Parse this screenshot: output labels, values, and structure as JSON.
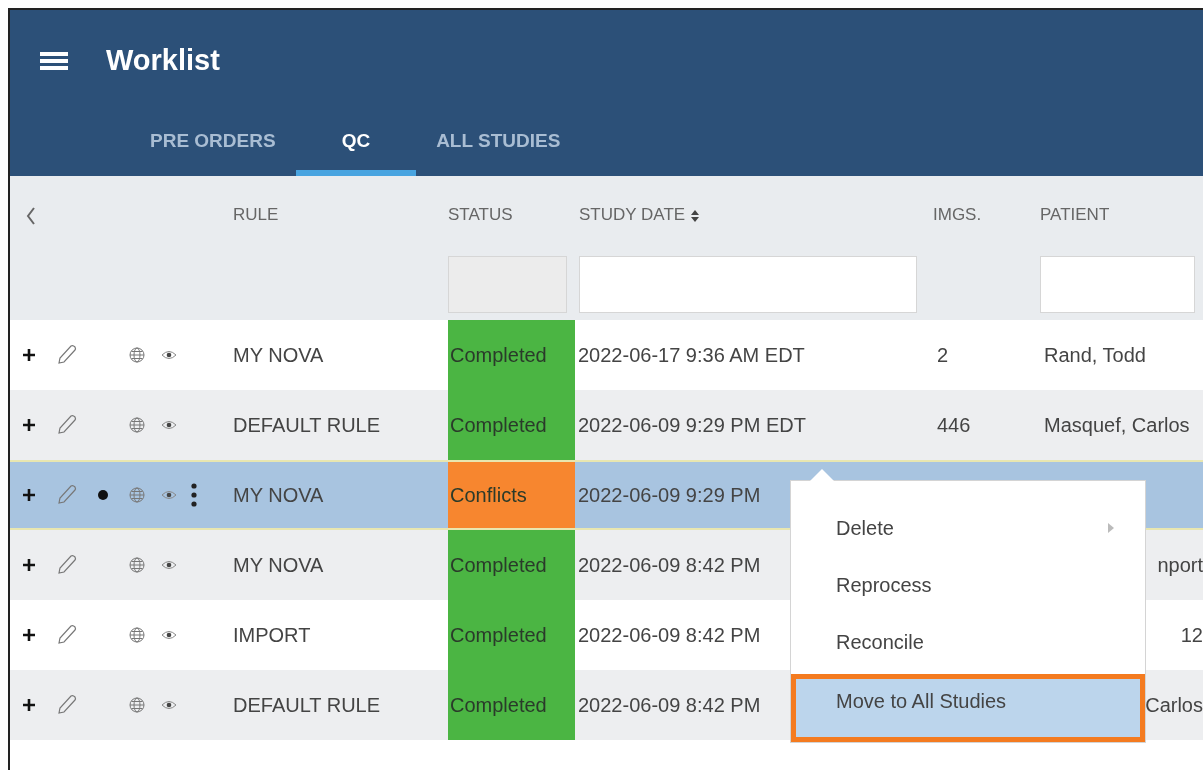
{
  "app_bar": {
    "title": "Worklist"
  },
  "tabs": [
    {
      "label": "PRE ORDERS",
      "selected": false
    },
    {
      "label": "QC",
      "selected": true
    },
    {
      "label": "ALL STUDIES",
      "selected": false
    }
  ],
  "table": {
    "columns": [
      {
        "label": "RULE",
        "sortable": false,
        "kind": "plain"
      },
      {
        "label": "STATUS",
        "sortable": false,
        "kind": "disabled"
      },
      {
        "label": "STUDY DATE",
        "sortable": true,
        "kind": "filter"
      },
      {
        "label": "IMGS.",
        "sortable": false,
        "kind": "plain"
      },
      {
        "label": "PATIENT",
        "sortable": false,
        "kind": "filter"
      }
    ],
    "rows": [
      {
        "selected": false,
        "flagged": false,
        "rule": "MY NOVA",
        "status": "Completed",
        "color": "#4bb543",
        "study_date": "2022-06-17 9:36 AM EDT",
        "imgs": "2",
        "patient": "Rand, Todd",
        "patient_partial": false
      },
      {
        "selected": false,
        "flagged": false,
        "rule": "DEFAULT RULE",
        "status": "Completed",
        "color": "#4bb543",
        "study_date": "2022-06-09 9:29 PM EDT",
        "imgs": "446",
        "patient": "Masquef, Carlos",
        "patient_partial": false
      },
      {
        "selected": true,
        "flagged": true,
        "rule": "MY NOVA",
        "status": "Conflicts",
        "color": "#f7862f",
        "study_date": "2022-06-09 9:29 PM",
        "patient_partial": false
      },
      {
        "selected": false,
        "flagged": false,
        "rule": "MY NOVA",
        "status": "Completed",
        "color": "#4bb543",
        "study_date": "2022-06-09 8:42 PM",
        "patient": "nport",
        "patient_partial": true
      },
      {
        "selected": false,
        "flagged": false,
        "rule": "IMPORT",
        "status": "Completed",
        "color": "#4bb543",
        "study_date": "2022-06-09 8:42 PM",
        "patient": "12",
        "patient_partial": true
      },
      {
        "selected": false,
        "flagged": false,
        "rule": "DEFAULT RULE",
        "status": "Completed",
        "color": "#4bb543",
        "study_date": "2022-06-09 8:42 PM",
        "patient": "Carlos",
        "patient_partial": true
      }
    ]
  },
  "context_menu": {
    "items": [
      {
        "label": "Delete",
        "submenu": true,
        "highlighted": false
      },
      {
        "label": "Reprocess",
        "submenu": false,
        "highlighted": false
      },
      {
        "label": "Reconcile",
        "submenu": false,
        "highlighted": false
      },
      {
        "label": "Move to All Studies",
        "submenu": false,
        "highlighted": true
      }
    ]
  }
}
